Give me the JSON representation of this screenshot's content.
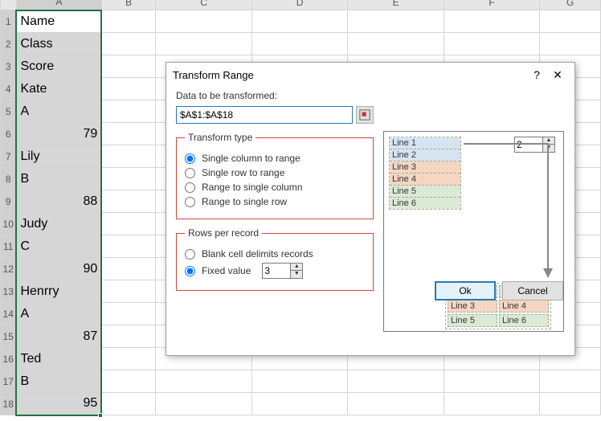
{
  "columns": [
    "A",
    "B",
    "C",
    "D",
    "E",
    "F",
    "G"
  ],
  "rows": [
    "1",
    "2",
    "3",
    "4",
    "5",
    "6",
    "7",
    "8",
    "9",
    "10",
    "11",
    "12",
    "13",
    "14",
    "15",
    "16",
    "17",
    "18"
  ],
  "cells": {
    "r1": "Name",
    "r2": "Class",
    "r3": "Score",
    "r4": "Kate",
    "r5": "A",
    "r6": "79",
    "r7": "Lily",
    "r8": "B",
    "r9": "88",
    "r10": "Judy",
    "r11": "C",
    "r12": "90",
    "r13": "Henrry",
    "r14": "A",
    "r15": "87",
    "r16": "Ted",
    "r17": "B",
    "r18": "95"
  },
  "dialog": {
    "title": "Transform Range",
    "label_data": "Data to be transformed:",
    "range_value": "$A$1:$A$18",
    "fs_transform": "Transform type",
    "opt1": "Single column to range",
    "opt2": "Single row to range",
    "opt3": "Range to single column",
    "opt4": "Range to single row",
    "fs_rows": "Rows per record",
    "opt_blank": "Blank cell delimits records",
    "opt_fixed": "Fixed value",
    "fixed_val": "3",
    "preview_val": "2",
    "prev_lines": {
      "l1": "Line 1",
      "l2": "Line 2",
      "l3": "Line 3",
      "l4": "Line 4",
      "l5": "Line 5",
      "l6": "Line 6"
    },
    "ok": "Ok",
    "cancel": "Cancel"
  }
}
